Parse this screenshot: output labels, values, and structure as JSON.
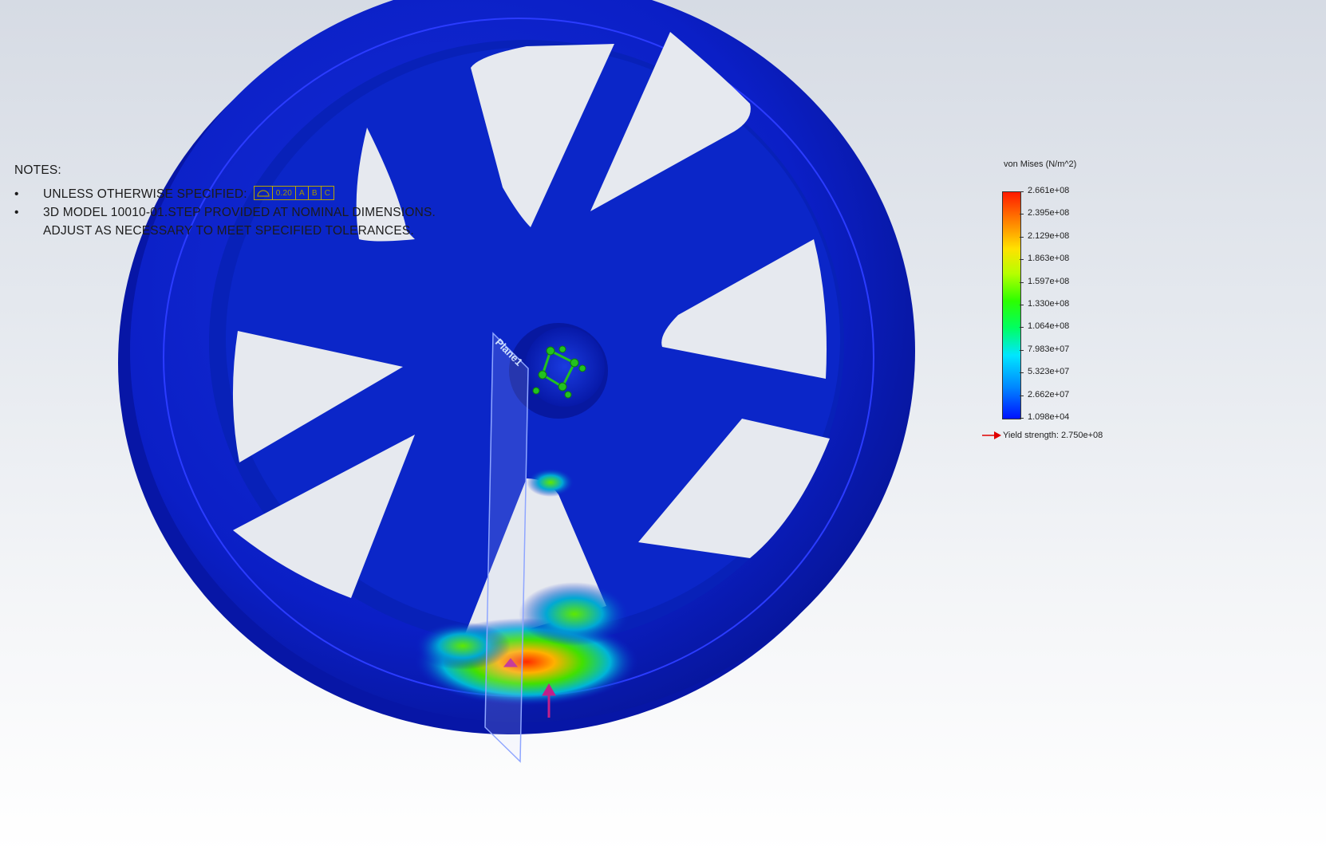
{
  "notes": {
    "title": "NOTES:",
    "bullet_symbol": "•",
    "items": [
      {
        "text": "UNLESS OTHERWISE SPECIFIED:"
      },
      {
        "text_line1": "3D MODEL 10010-01.STEP PROVIDED AT NOMINAL DIMENSIONS.",
        "text_line2": "ADJUST AS NECESSARY TO MEET SPECIFIED TOLERANCES."
      }
    ],
    "tolerance_frame": {
      "symbol_icon": "surface-profile-icon",
      "value": "0.20",
      "datums": [
        "A",
        "B",
        "C"
      ]
    }
  },
  "model": {
    "plane_label": "Plane1",
    "fixture_icon": "fixed-geometry-icon",
    "load_icon": "force-arrow-icon"
  },
  "legend": {
    "title": "von Mises (N/m^2)",
    "values": [
      "2.661e+08",
      "2.395e+08",
      "2.129e+08",
      "1.863e+08",
      "1.597e+08",
      "1.330e+08",
      "1.064e+08",
      "7.983e+07",
      "5.323e+07",
      "2.662e+07",
      "1.098e+04"
    ],
    "yield_label": "Yield strength: 2.750e+08",
    "yield_icon": "yield-arrow-icon"
  },
  "colors": {
    "model_blue": "#0a1ec8",
    "model_dark": "#050f8a",
    "stress_high": "#ff1a00",
    "stress_low": "#0012ff",
    "yield_marker": "#e00000",
    "fixture_green": "#22c21e",
    "load_magenta": "#c2208a",
    "annotation_yellow": "#b9a400"
  }
}
